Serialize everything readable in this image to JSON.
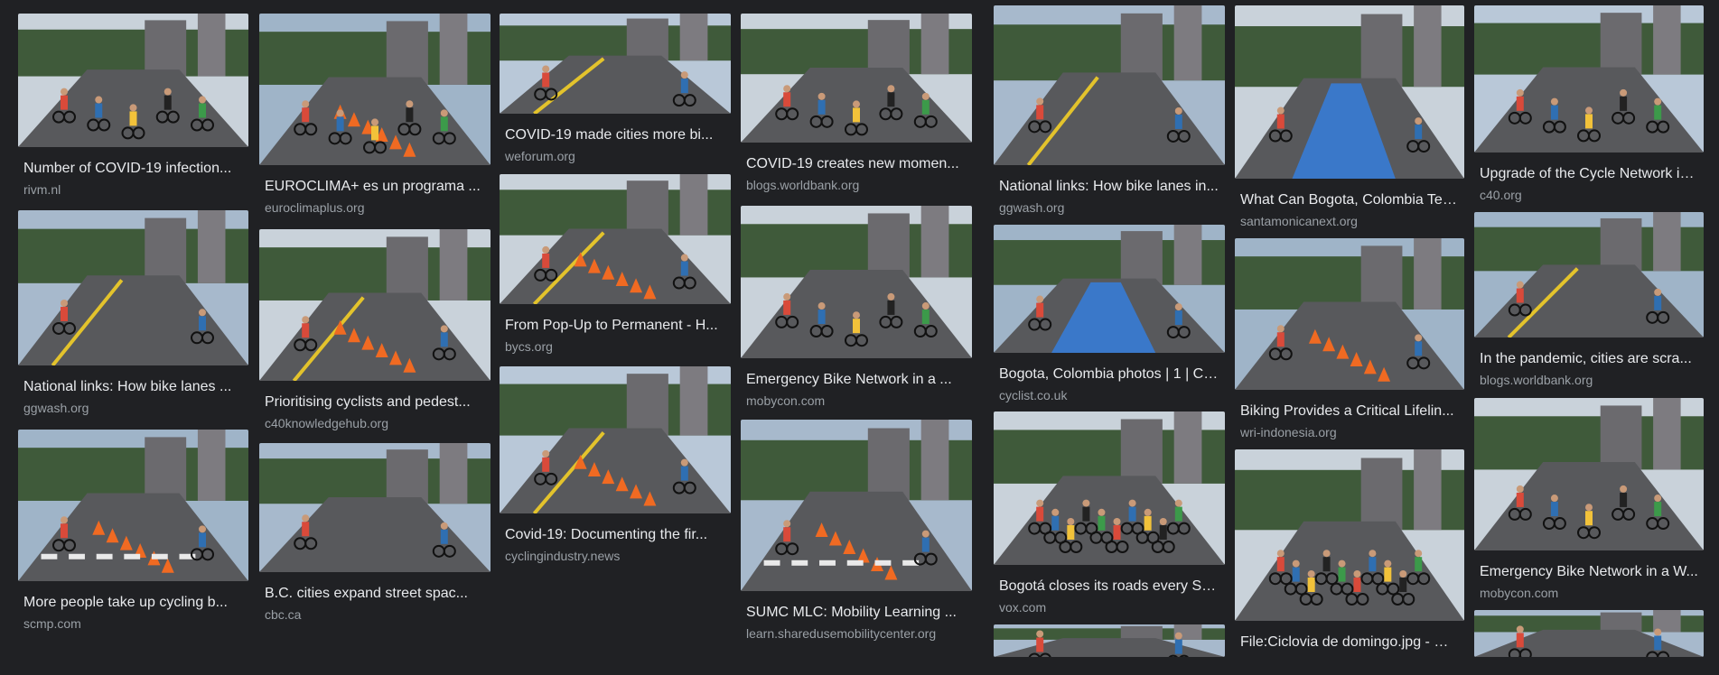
{
  "results": [
    {
      "title": "Number of COVID-19 infection...",
      "source": "rivm.nl",
      "scene": "plaza-cyclists"
    },
    {
      "title": "National links: How bike lanes ...",
      "source": "ggwash.org",
      "scene": "bike-lane-rider"
    },
    {
      "title": "More people take up cycling b...",
      "source": "scmp.com",
      "scene": "crosswalk-cyclist"
    },
    {
      "title": "EUROCLIMA+ es un programa ...",
      "source": "euroclimaplus.org",
      "scene": "avenue-cyclists-cones"
    },
    {
      "title": "Prioritising cyclists and pedest...",
      "source": "c40knowledgehub.org",
      "scene": "cone-lane-park"
    },
    {
      "title": "B.C. cities expand street spac...",
      "source": "cbc.ca",
      "scene": "park-road-signs"
    },
    {
      "title": "COVID-19 made cities more bi...",
      "source": "weforum.org",
      "scene": "bus-lane-cyclist"
    },
    {
      "title": "From Pop-Up to Permanent - H...",
      "source": "bycs.org",
      "scene": "popup-lane"
    },
    {
      "title": "Covid-19: Documenting the fir...",
      "source": "cyclingindustry.news",
      "scene": "cone-lane-couple"
    },
    {
      "title": "COVID-19 creates new momen...",
      "source": "blogs.worldbank.org",
      "scene": "tree-road-cyclists"
    },
    {
      "title": "Emergency Bike Network in a ...",
      "source": "mobycon.com",
      "scene": "busy-road-cyclists"
    },
    {
      "title": "SUMC MLC: Mobility Learning ...",
      "source": "learn.sharedusemobilitycenter.org",
      "scene": "crosswalk-signs"
    },
    {
      "title": "National links: How bike lanes in...",
      "source": "ggwash.org",
      "scene": "bike-lane-rider"
    },
    {
      "title": "Bogota, Colombia photos | 1 | Cy...",
      "source": "cyclist.co.uk",
      "scene": "blue-lane"
    },
    {
      "title": "Bogotá closes its roads every Su...",
      "source": "vox.com",
      "scene": "crowd-cyclists"
    },
    {
      "title": "",
      "source": "",
      "scene": "partial"
    },
    {
      "title": "What Can Bogota, Colombia Tea...",
      "source": "santamonicanext.org",
      "scene": "blue-lane-city"
    },
    {
      "title": "Biking Provides a Critical Lifelin...",
      "source": "wri-indonesia.org",
      "scene": "cones-cars-riders"
    },
    {
      "title": "File:Ciclovia de domingo.jpg - Wi...",
      "source": "",
      "scene": "ciclovia-crowd"
    },
    {
      "title": "Upgrade of the Cycle Network in...",
      "source": "c40.org",
      "scene": "bus-cyclists"
    },
    {
      "title": "In the pandemic, cities are scra...",
      "source": "blogs.worldbank.org",
      "scene": "lane-riders-trees"
    },
    {
      "title": "Emergency Bike Network in a W...",
      "source": "mobycon.com",
      "scene": "busy-road-cyclists"
    },
    {
      "title": "",
      "source": "",
      "scene": "partial"
    }
  ],
  "colors": {
    "background": "#202124",
    "title": "#e8eaed",
    "source": "#9aa0a6"
  }
}
